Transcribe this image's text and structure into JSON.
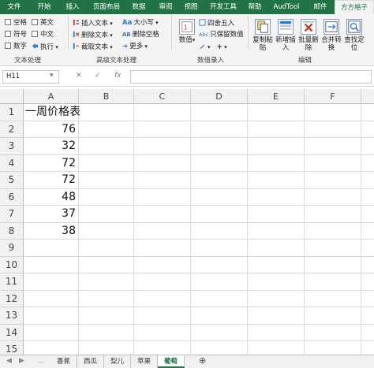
{
  "ribbon_tabs": [
    {
      "label": "文件"
    },
    {
      "label": "开始"
    },
    {
      "label": "插入"
    },
    {
      "label": "页面布局"
    },
    {
      "label": "数据"
    },
    {
      "label": "审阅"
    },
    {
      "label": "视图"
    },
    {
      "label": "开发工具"
    },
    {
      "label": "帮助"
    },
    {
      "label": "AudTool"
    },
    {
      "label": "邮件"
    },
    {
      "label": "方方格子",
      "active": true
    }
  ],
  "ribbon": {
    "text_group": {
      "checks": [
        "空格",
        "英文",
        "符号",
        "中文",
        "数字",
        "执行"
      ],
      "label": "文本处理"
    },
    "adv_text_group": {
      "items": [
        "插入文本",
        "删除文本",
        "截取文本",
        "大小写",
        "删除空格",
        "更多"
      ],
      "label": "高级文本处理"
    },
    "input_group": {
      "numeric": "数值",
      "items": [
        "四舍五入",
        "只保留数值"
      ],
      "label": "数值录入"
    },
    "edit_group": {
      "buttons": [
        "复制粘贴",
        "新增插入",
        "批量删除",
        "合并转换",
        "查找定位"
      ],
      "label": "编辑"
    }
  },
  "formula_bar": {
    "name_box": "H11",
    "fx": "fx",
    "formula": ""
  },
  "columns": [
    "A",
    "B",
    "C",
    "D",
    "E",
    "F"
  ],
  "rows": [
    "1",
    "2",
    "3",
    "4",
    "5",
    "6",
    "7",
    "8",
    "9",
    "10",
    "11",
    "12",
    "13",
    "14",
    "15"
  ],
  "cells": {
    "A1": "一周价格表",
    "A2": "76",
    "A3": "32",
    "A4": "72",
    "A5": "72",
    "A6": "48",
    "A7": "37",
    "A8": "38"
  },
  "sheets": [
    {
      "label": "香蕉"
    },
    {
      "label": "西瓜"
    },
    {
      "label": "梨儿"
    },
    {
      "label": "苹果"
    },
    {
      "label": "葡萄",
      "active": true
    }
  ],
  "add_sheet": "⊕",
  "colors": {
    "brand": "#217346"
  }
}
